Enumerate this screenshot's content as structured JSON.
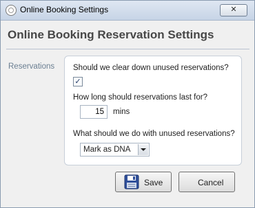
{
  "window": {
    "title": "Online Booking Settings",
    "close_label": "✕"
  },
  "header": {
    "title": "Online Booking Reservation Settings"
  },
  "reservations": {
    "section_label": "Reservations",
    "clear_down_question": "Should we clear down unused reservations?",
    "clear_down_checked": true,
    "duration_question": "How long should reservations last for?",
    "duration_value": "15",
    "duration_unit": "mins",
    "unused_question": "What should we do with unused reservations?",
    "unused_action_selected": "Mark as DNA"
  },
  "buttons": {
    "save_label": "Save",
    "cancel_label": "Cancel"
  },
  "icons": {
    "app": "app-icon",
    "close": "close-icon",
    "save": "floppy-disk-icon",
    "dropdown": "chevron-down-icon",
    "check": "checkmark-icon"
  }
}
